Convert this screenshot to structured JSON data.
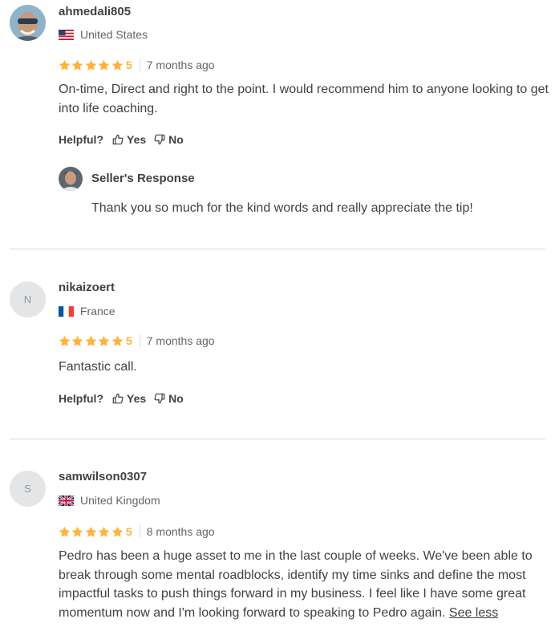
{
  "colors": {
    "star": "#ffb33e",
    "text": "#404145",
    "muted": "#62646a",
    "divider": "#dadbdd"
  },
  "ui": {
    "helpful": "Helpful?",
    "yes": "Yes",
    "no": "No"
  },
  "reviews": [
    {
      "username": "ahmedali805",
      "country": "United States",
      "flag": "us-flag",
      "rating": "5",
      "time_ago": "7 months ago",
      "text": "On-time, Direct and right to the point. I would recommend him to anyone looking to get into life coaching.",
      "seller_response": {
        "title": "Seller's Response",
        "text": "Thank you so much for the kind words and really appreciate the tip!"
      }
    },
    {
      "username": "nikaizoert",
      "avatar_letter": "N",
      "country": "France",
      "flag": "fr-flag",
      "rating": "5",
      "time_ago": "7 months ago",
      "text": "Fantastic call."
    },
    {
      "username": "samwilson0307",
      "avatar_letter": "S",
      "country": "United Kingdom",
      "flag": "uk-flag",
      "rating": "5",
      "time_ago": "8 months ago",
      "text": "Pedro has been a huge asset to me in the last couple of weeks. We've been able to break through some mental roadblocks, identify my time sinks and define the most impactful tasks to push things forward in my business. I feel like I have some great momentum now and I'm looking forward to speaking to Pedro again.",
      "see_less": "See less"
    }
  ]
}
